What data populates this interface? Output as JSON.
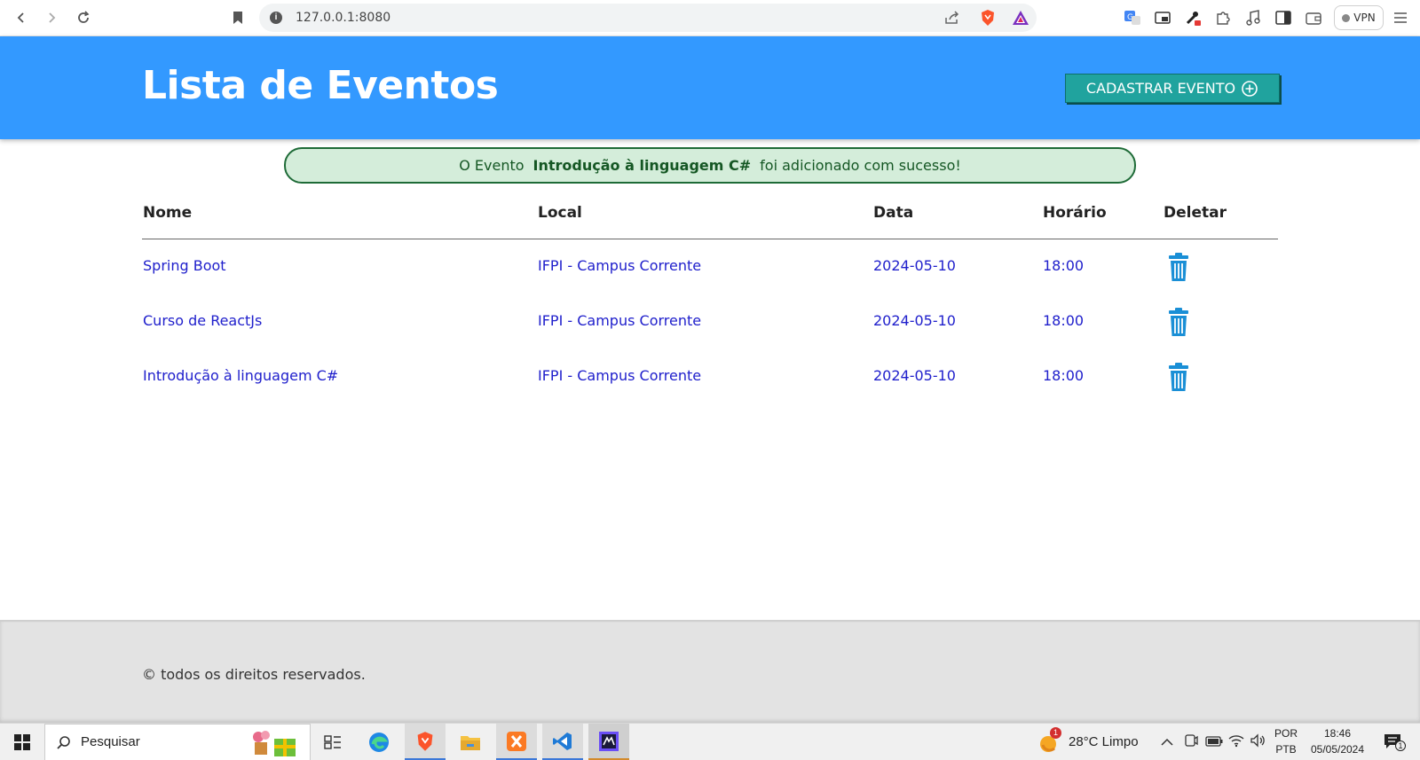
{
  "browser": {
    "url": "127.0.0.1:8080",
    "vpn_label": "VPN"
  },
  "header": {
    "title": "Lista de Eventos",
    "register_button": "CADASTRAR EVENTO"
  },
  "alert": {
    "prefix": "O Evento",
    "event_name": "Introdução à linguagem C#",
    "suffix": "foi adicionado com sucesso!"
  },
  "table": {
    "headers": [
      "Nome",
      "Local",
      "Data",
      "Horário",
      "Deletar"
    ],
    "rows": [
      {
        "nome": "Spring Boot",
        "local": "IFPI - Campus Corrente",
        "data": "2024-05-10",
        "horario": "18:00"
      },
      {
        "nome": "Curso de ReactJs",
        "local": "IFPI - Campus Corrente",
        "data": "2024-05-10",
        "horario": "18:00"
      },
      {
        "nome": "Introdução à linguagem C#",
        "local": "IFPI - Campus Corrente",
        "data": "2024-05-10",
        "horario": "18:00"
      }
    ]
  },
  "footer": {
    "text": "© todos os direitos reservados."
  },
  "taskbar": {
    "search_placeholder": "Pesquisar",
    "weather": "28°C  Limpo",
    "weather_badge": "1",
    "lang_top": "POR",
    "lang_bottom": "PTB",
    "time": "18:46",
    "date": "05/05/2024",
    "notif_count": "1"
  },
  "colors": {
    "header_bg": "#3399ff",
    "button_bg": "#20a39e",
    "alert_bg": "#d4edda",
    "link_text": "#2020cc",
    "trash_icon": "#1a8fd6"
  }
}
